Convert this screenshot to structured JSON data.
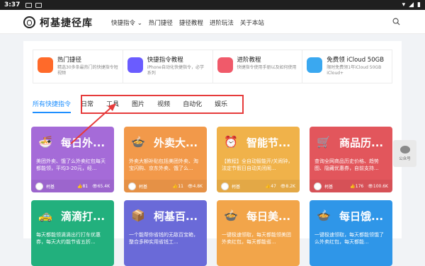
{
  "status": {
    "time": "3:37"
  },
  "header": {
    "brand": "柯基捷径库",
    "nav": [
      "快捷指令",
      "热门捷径",
      "捷径教程",
      "进阶玩法",
      "关于本站"
    ]
  },
  "features": [
    {
      "title": "热门捷径",
      "desc": "精选30多条最热门的快捷指令短视频",
      "color": "#ff6a2a"
    },
    {
      "title": "快捷指令教程",
      "desc": "iPhone自动化快捷指令，必学系列",
      "color": "#6a5cff"
    },
    {
      "title": "进阶教程",
      "desc": "快捷指令使用手册以及如何使用",
      "color": "#f05a6a"
    },
    {
      "title": "免费领 iCloud 50GB",
      "desc": "限时免费领1年iCloud 50GB iCloud+",
      "color": "#3aa8f0"
    }
  ],
  "tabs": [
    "所有快捷指令",
    "日常",
    "工具",
    "图片",
    "视频",
    "自动化",
    "娱乐"
  ],
  "cards": [
    {
      "title": "每日外...",
      "desc": "美团外卖、饿了么外卖红包每天都能领，平均3-20元，经...",
      "author": "柯基",
      "likes": "81",
      "views": "65.4K",
      "color": "#a56bd8"
    },
    {
      "title": "外卖大...",
      "desc": "外卖大额补贴包括美团外卖、淘宝闪购、京东外卖、饿了么...",
      "author": "柯基",
      "likes": "11",
      "views": "4.8K",
      "color": "#f2994a"
    },
    {
      "title": "智能节...",
      "desc": "【教程】全自动智能开/关闹钟，法定节假日自动关闭闹...",
      "author": "柯基",
      "likes": "47",
      "views": "8.2K",
      "color": "#f0b24a"
    },
    {
      "title": "商品历...",
      "desc": "查询全网商品历史价格、趋势图、隐藏优惠券，自前支持...",
      "author": "柯基",
      "likes": "176",
      "views": "100.6K",
      "color": "#e2565c"
    },
    {
      "title": "滴滴打...",
      "desc": "每天都能领滴滴出行打车优惠券，每天大约能节省五折...",
      "author": "",
      "likes": "",
      "views": "",
      "color": "#22b07d"
    },
    {
      "title": "柯基百...",
      "desc": "一个能帮你省钱的无敌百宝箱，整合多种实用省钱工...",
      "author": "",
      "likes": "",
      "views": "",
      "color": "#6a6ad8"
    },
    {
      "title": "每日美...",
      "desc": "一键极速领取，每天都能领美团外卖红包，每天都能省...",
      "author": "",
      "likes": "",
      "views": "",
      "color": "#f2a54a"
    },
    {
      "title": "每日饿...",
      "desc": "一键极速领取，每天都能领饿了么外卖红包，每天都能...",
      "author": "",
      "likes": "",
      "views": "",
      "color": "#2f96e8"
    }
  ],
  "side": {
    "label": "公众号"
  }
}
